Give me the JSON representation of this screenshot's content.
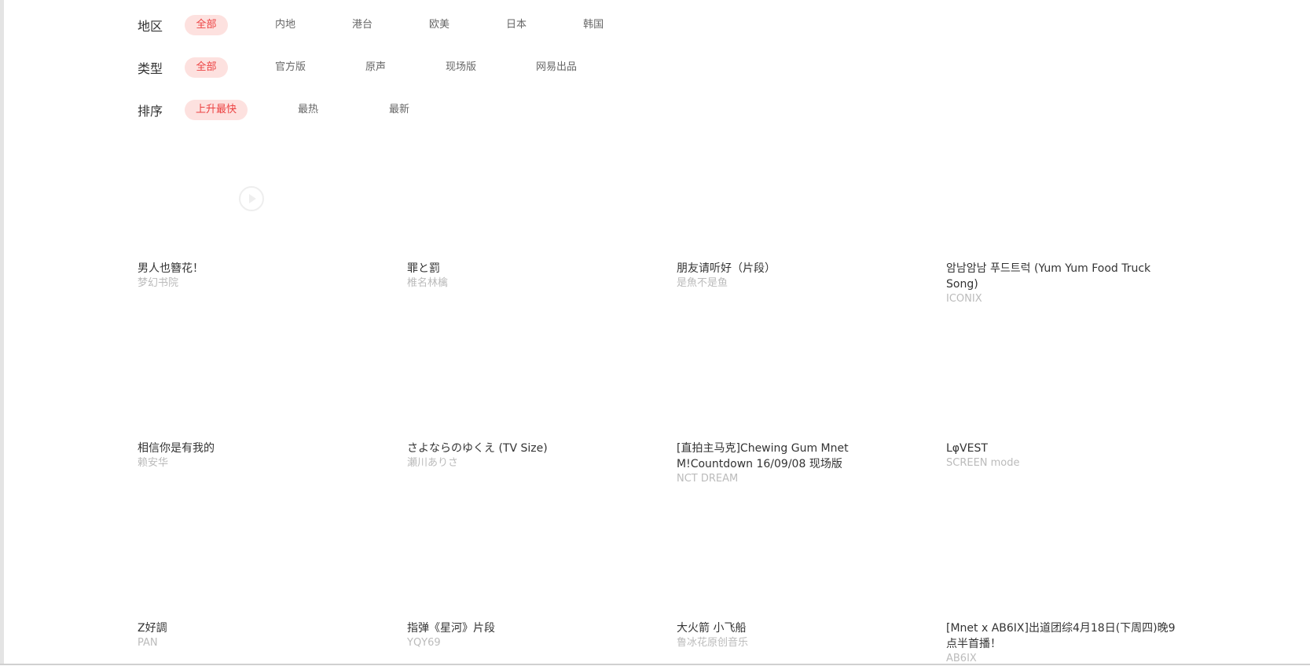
{
  "filters": {
    "area": {
      "label": "地区",
      "options": [
        "全部",
        "内地",
        "港台",
        "欧美",
        "日本",
        "韩国"
      ],
      "selected": "全部"
    },
    "type": {
      "label": "类型",
      "options": [
        "全部",
        "官方版",
        "原声",
        "现场版",
        "网易出品"
      ],
      "selected": "全部"
    },
    "sort": {
      "label": "排序",
      "options": [
        "上升最快",
        "最热",
        "最新"
      ],
      "selected": "上升最快"
    }
  },
  "videos": [
    {
      "title": "男人也簪花！",
      "artist": "梦幻书院"
    },
    {
      "title": "罪と罰",
      "artist": "椎名林檎"
    },
    {
      "title": "朋友请听好（片段）",
      "artist": "是魚不是鱼"
    },
    {
      "title": "암남암남 푸드트럭 (Yum Yum Food Truck Song)",
      "artist": "ICONIX"
    },
    {
      "title": "相信你是有我的",
      "artist": "赖安华"
    },
    {
      "title": "さよならのゆくえ (TV Size)",
      "artist": "瀬川ありさ"
    },
    {
      "title": "[直拍主马克]Chewing Gum Mnet M!Countdown 16/09/08 现场版",
      "artist": "NCT DREAM"
    },
    {
      "title": "LφVEST",
      "artist": "SCREEN mode"
    },
    {
      "title": "Z好調",
      "artist": "PAN"
    },
    {
      "title": "指弹《星河》片段",
      "artist": "YQY69"
    },
    {
      "title": "大火箭 小飞船",
      "artist": "鲁冰花原创音乐"
    },
    {
      "title": "[Mnet x AB6IX]出道团综4月18日(下周四)晚9点半首播！",
      "artist": "AB6IX"
    }
  ],
  "colors": {
    "accent": "#ec4141",
    "accent_bg": "#fde1df",
    "title_text": "#333333",
    "artist_text": "#bbbbbb"
  },
  "icons": {
    "play": "play-circle-icon"
  }
}
